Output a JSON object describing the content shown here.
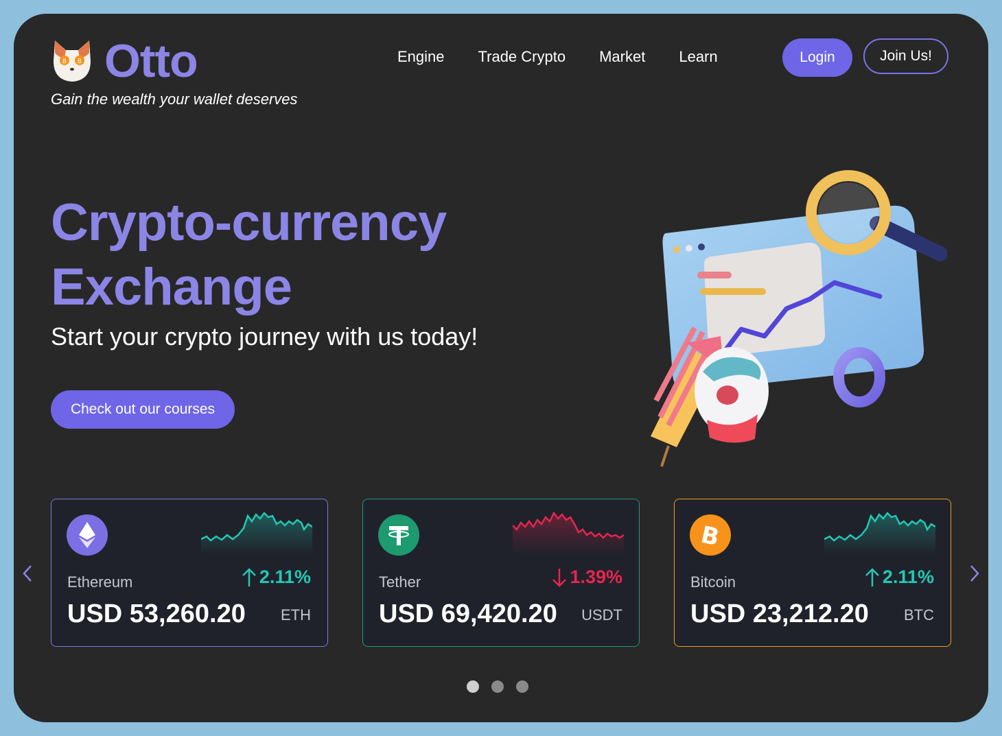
{
  "brand": {
    "name": "Otto",
    "tagline": "Gain the wealth your wallet deserves",
    "accent": "#8b85e6",
    "button_color": "#6e66e6"
  },
  "nav": {
    "items": [
      "Engine",
      "Trade Crypto",
      "Market",
      "Learn"
    ],
    "login": "Login",
    "join": "Join Us!"
  },
  "hero": {
    "title_line1": "Crypto-currency",
    "title_line2": "Exchange",
    "subtitle": "Start your crypto journey with us today!",
    "cta": "Check out our courses"
  },
  "cards": [
    {
      "name": "Ethereum",
      "change": "2.11%",
      "direction": "up",
      "price": "USD 53,260.20",
      "symbol": "ETH",
      "icon": "ethereum-icon",
      "border": "#7d78d8",
      "icon_bg": "#7b6fe3"
    },
    {
      "name": "Tether",
      "change": "1.39%",
      "direction": "down",
      "price": "USD 69,420.20",
      "symbol": "USDT",
      "icon": "tether-icon",
      "border": "#1f9a76",
      "icon_bg": "#1d9a6f"
    },
    {
      "name": "Bitcoin",
      "change": "2.11%",
      "direction": "up",
      "price": "USD 23,212.20",
      "symbol": "BTC",
      "icon": "bitcoin-icon",
      "border": "#f29a1f",
      "icon_bg": "#f7931a"
    }
  ],
  "colors": {
    "up": "#22c9b4",
    "down": "#e8254f"
  },
  "carousel": {
    "active_page": 1,
    "total_pages": 3
  }
}
